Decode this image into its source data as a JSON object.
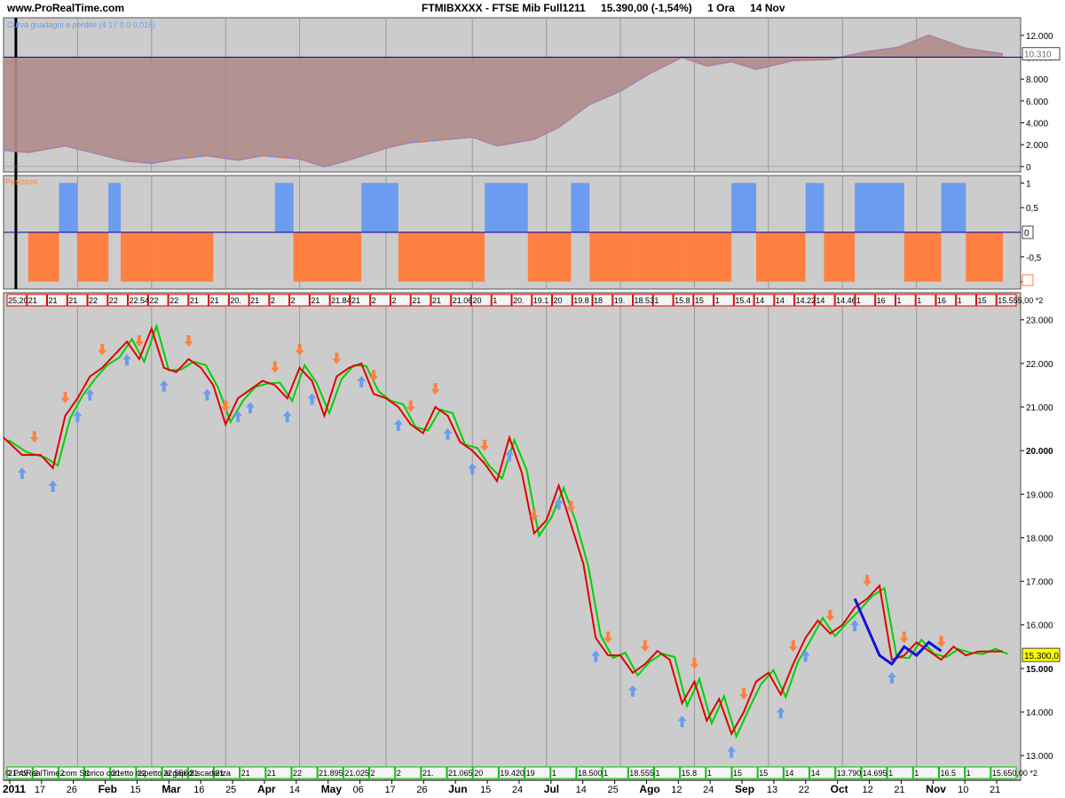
{
  "header": {
    "site": "www.ProRealTime.com",
    "instrument": "FTMIBXXXX - FTSE Mib Full1211",
    "last_price": "15.390,00 (-1,54%)",
    "timeframe": "1 Ora",
    "date": "14 Nov"
  },
  "colors": {
    "panel_bg": "#cccccc",
    "equity_fill": "#b08c8c",
    "equity_fill_positive": "#8fa88f",
    "equity_line": "#f08040",
    "equity_line2": "#6c8cff",
    "position_long": "#6c9cf0",
    "position_short": "#ff8040",
    "price_red": "#e00000",
    "price_green": "#00d000",
    "arrow_sell": "#ff8040",
    "arrow_buy": "#6c9cf0",
    "baseline": "#0000a0",
    "label_red": "#e00000",
    "label_green": "#00c000"
  },
  "panels": {
    "equity": {
      "label": "Curva guadagni e perdite (4 17 0 0 0,016)",
      "badge": "10.310"
    },
    "position": {
      "label": "Posizioni"
    },
    "price": {
      "top_labels": [
        "25,20",
        "21",
        "21",
        "21",
        "22",
        "22",
        "22.540",
        "22",
        "22",
        "21",
        "21",
        "20.",
        "21",
        "2",
        "2",
        "21",
        "21.840,00 *2",
        "21",
        "2",
        "2",
        "21",
        "21",
        "21.060",
        "20",
        "1",
        "20.",
        "19.1",
        "20",
        "19.8",
        "18",
        "19.",
        "18.535",
        "1",
        "15.8",
        "15",
        "1",
        "15.4",
        "14",
        "14",
        "14.225",
        "14",
        "14.46",
        "1",
        "16",
        "1",
        "1",
        "16",
        "1",
        "15",
        "15.555,00 *2"
      ],
      "bottom_labels": [
        "21.49",
        "2",
        "2",
        "1",
        "21",
        "22",
        "22.556",
        "21",
        "21",
        "21",
        "21",
        "22",
        "21.895",
        "21.025,00",
        "2",
        "2",
        "21.",
        "21.065",
        "20",
        "19.420",
        "19",
        "1",
        "18.500",
        "1",
        "18.555",
        "1",
        "15.8",
        "1",
        "15",
        "15",
        "14",
        "14",
        "13.790",
        "14.695",
        "1",
        "1",
        "16.5",
        "1",
        "15.650,00 *2"
      ],
      "footer": "© ProRealTime.com Storico corretto rispetto ai gap di scadenza",
      "price_badge": "15.300,0"
    }
  },
  "axes": {
    "equity_ticks": [
      "12.000",
      "10.000",
      "8.000",
      "6.000",
      "4.000",
      "2.000",
      "0"
    ],
    "position_ticks": [
      "1",
      "0,5",
      "0",
      "-0,5",
      "-1"
    ],
    "position_badge": "0",
    "price_ticks": [
      "23.000",
      "22.000",
      "21.000",
      "20.000",
      "19.000",
      "18.000",
      "17.000",
      "16.000",
      "15.000",
      "14.000",
      "13.000"
    ],
    "time_labels": [
      {
        "label": "2011",
        "bold": true
      },
      {
        "label": "17",
        "bold": false
      },
      {
        "label": "26",
        "bold": false
      },
      {
        "label": "Feb",
        "bold": true
      },
      {
        "label": "15",
        "bold": false
      },
      {
        "label": "Mar",
        "bold": true
      },
      {
        "label": "16",
        "bold": false
      },
      {
        "label": "25",
        "bold": false
      },
      {
        "label": "Apr",
        "bold": true
      },
      {
        "label": "14",
        "bold": false
      },
      {
        "label": "May",
        "bold": true
      },
      {
        "label": "06",
        "bold": false
      },
      {
        "label": "17",
        "bold": false
      },
      {
        "label": "26",
        "bold": false
      },
      {
        "label": "Jun",
        "bold": true
      },
      {
        "label": "15",
        "bold": false
      },
      {
        "label": "24",
        "bold": false
      },
      {
        "label": "Jul",
        "bold": true
      },
      {
        "label": "14",
        "bold": false
      },
      {
        "label": "25",
        "bold": false
      },
      {
        "label": "Ago",
        "bold": true
      },
      {
        "label": "12",
        "bold": false
      },
      {
        "label": "24",
        "bold": false
      },
      {
        "label": "Sep",
        "bold": true
      },
      {
        "label": "13",
        "bold": false
      },
      {
        "label": "22",
        "bold": false
      },
      {
        "label": "Oct",
        "bold": true
      },
      {
        "label": "12",
        "bold": false
      },
      {
        "label": "21",
        "bold": false
      },
      {
        "label": "Nov",
        "bold": true
      },
      {
        "label": "10",
        "bold": false
      },
      {
        "label": "21",
        "bold": false
      }
    ]
  },
  "chart_data": [
    {
      "type": "area",
      "name": "Curva guadagni e perdite",
      "ylim": [
        -500,
        12800
      ],
      "x_index": [
        0,
        4,
        10,
        15,
        20,
        24,
        28,
        33,
        38,
        42,
        48,
        52,
        56,
        62,
        66,
        70,
        76,
        80,
        86,
        90,
        95,
        100,
        105,
        110,
        114,
        118,
        122,
        128,
        134,
        140,
        145,
        150,
        156,
        162
      ],
      "values": [
        1500,
        1300,
        1900,
        1200,
        500,
        300,
        700,
        1000,
        600,
        1000,
        700,
        0,
        600,
        1700,
        2200,
        2400,
        2700,
        1900,
        2500,
        3600,
        5700,
        6900,
        8600,
        10000,
        9200,
        9600,
        8900,
        9700,
        9800,
        10500,
        10900,
        12000,
        10800,
        10300
      ]
    },
    {
      "type": "bar",
      "name": "Posizioni",
      "ylim": [
        -1.15,
        1.15
      ],
      "segments": [
        {
          "x0": 4,
          "x1": 9,
          "value": -1
        },
        {
          "x0": 9,
          "x1": 12,
          "value": 1
        },
        {
          "x0": 12,
          "x1": 17,
          "value": -1
        },
        {
          "x0": 17,
          "x1": 19,
          "value": 1
        },
        {
          "x0": 19,
          "x1": 25,
          "value": -1
        },
        {
          "x0": 25,
          "x1": 29,
          "value": -1
        },
        {
          "x0": 29,
          "x1": 34,
          "value": -1
        },
        {
          "x0": 44,
          "x1": 47,
          "value": 1
        },
        {
          "x0": 47,
          "x1": 52,
          "value": -1
        },
        {
          "x0": 52,
          "x1": 58,
          "value": -1
        },
        {
          "x0": 58,
          "x1": 64,
          "value": 1
        },
        {
          "x0": 64,
          "x1": 70,
          "value": -1
        },
        {
          "x0": 70,
          "x1": 78,
          "value": -1
        },
        {
          "x0": 78,
          "x1": 85,
          "value": 1
        },
        {
          "x0": 85,
          "x1": 92,
          "value": -1
        },
        {
          "x0": 92,
          "x1": 95,
          "value": 1
        },
        {
          "x0": 95,
          "x1": 103,
          "value": -1
        },
        {
          "x0": 103,
          "x1": 110,
          "value": -1
        },
        {
          "x0": 110,
          "x1": 118,
          "value": -1
        },
        {
          "x0": 118,
          "x1": 122,
          "value": 1
        },
        {
          "x0": 122,
          "x1": 130,
          "value": -1
        },
        {
          "x0": 130,
          "x1": 133,
          "value": 1
        },
        {
          "x0": 133,
          "x1": 138,
          "value": -1
        },
        {
          "x0": 138,
          "x1": 142,
          "value": 1
        },
        {
          "x0": 142,
          "x1": 146,
          "value": 1
        },
        {
          "x0": 146,
          "x1": 152,
          "value": -1
        },
        {
          "x0": 152,
          "x1": 156,
          "value": 1
        },
        {
          "x0": 156,
          "x1": 162,
          "value": -1
        }
      ]
    },
    {
      "type": "line",
      "name": "FTMIBXXXX - FTSE Mib Full1211",
      "ylim": [
        12800,
        23300
      ],
      "x_index": [
        0,
        3,
        6,
        8,
        10,
        12,
        14,
        16,
        18,
        20,
        22,
        24,
        26,
        28,
        30,
        32,
        34,
        36,
        38,
        40,
        42,
        44,
        46,
        48,
        50,
        52,
        54,
        56,
        58,
        60,
        62,
        64,
        66,
        68,
        70,
        72,
        74,
        76,
        78,
        80,
        82,
        84,
        86,
        88,
        90,
        92,
        94,
        96,
        98,
        100,
        102,
        104,
        106,
        108,
        110,
        112,
        114,
        116,
        118,
        120,
        122,
        124,
        126,
        128,
        130,
        132,
        134,
        136,
        138,
        140,
        142,
        144,
        146,
        148,
        150,
        152,
        154,
        156,
        158,
        160,
        162
      ],
      "values": [
        20300,
        19900,
        19900,
        19600,
        20800,
        21200,
        21700,
        21900,
        22200,
        22500,
        22100,
        22800,
        21900,
        21800,
        22100,
        21900,
        21500,
        20600,
        21200,
        21400,
        21600,
        21500,
        21200,
        21900,
        21600,
        20800,
        21700,
        21900,
        22000,
        21300,
        21200,
        21000,
        20600,
        20400,
        21000,
        20800,
        20200,
        20000,
        19700,
        19300,
        20300,
        19500,
        18100,
        18400,
        19200,
        18300,
        17400,
        15700,
        15300,
        15300,
        14900,
        15100,
        15400,
        15200,
        14200,
        14700,
        13800,
        14300,
        13500,
        14000,
        14700,
        14900,
        14400,
        15100,
        15700,
        16100,
        15800,
        16000,
        16400,
        16600,
        16900,
        15200,
        15300,
        15600,
        15400,
        15200,
        15500,
        15300,
        15390,
        15390,
        15390
      ],
      "buy_arrows_x": [
        3,
        8,
        12,
        14,
        20,
        26,
        33,
        38,
        40,
        46,
        50,
        58,
        64,
        72,
        76,
        82,
        90,
        96,
        102,
        110,
        118,
        126,
        130,
        138,
        144
      ],
      "sell_arrows_x": [
        5,
        10,
        16,
        22,
        30,
        36,
        44,
        48,
        54,
        60,
        66,
        70,
        78,
        86,
        92,
        98,
        104,
        112,
        120,
        128,
        134,
        140,
        146,
        152
      ],
      "blue_segment_x": [
        138,
        142,
        144,
        146,
        148,
        150,
        152
      ],
      "blue_segment_values": [
        16600,
        15300,
        15100,
        15500,
        15300,
        15600,
        15400
      ]
    }
  ]
}
